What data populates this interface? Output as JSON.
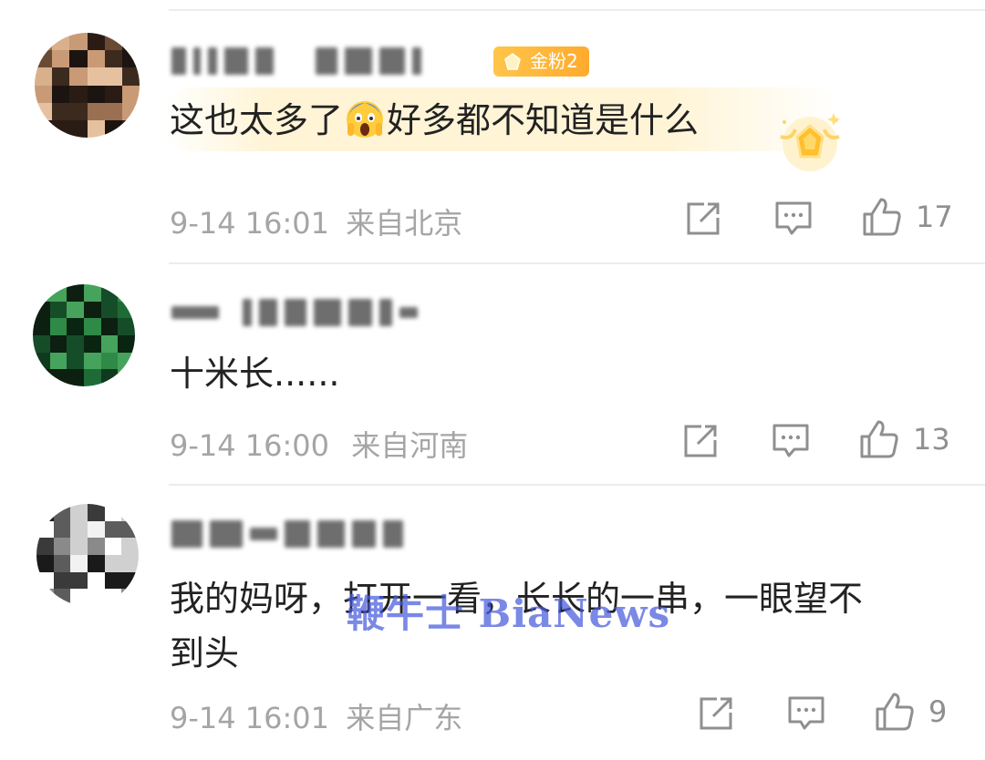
{
  "comments": [
    {
      "badge_label": "金粉2",
      "text_before_emoji": "这也太多了",
      "emoji": "screaming-face",
      "text_after_emoji": "好多都不知道是什么",
      "time": "9-14 16:01",
      "location": "来自北京",
      "likes": "17"
    },
    {
      "text": "十米长......",
      "time": "9-14 16:00",
      "location": "来自河南",
      "likes": "13"
    },
    {
      "text_line1": "我的妈呀，打开一看，长长的一串，一眼望不",
      "text_line2": "到头",
      "time": "9-14 16:01",
      "location": "来自广东",
      "likes": "9"
    }
  ],
  "watermark": "鞭牛士 BiaNews",
  "colors": {
    "badge": "#ffb43a",
    "meta_text": "#a5a5a5",
    "icon_gray": "#8f8f8f",
    "watermark": "#4a5adc"
  }
}
